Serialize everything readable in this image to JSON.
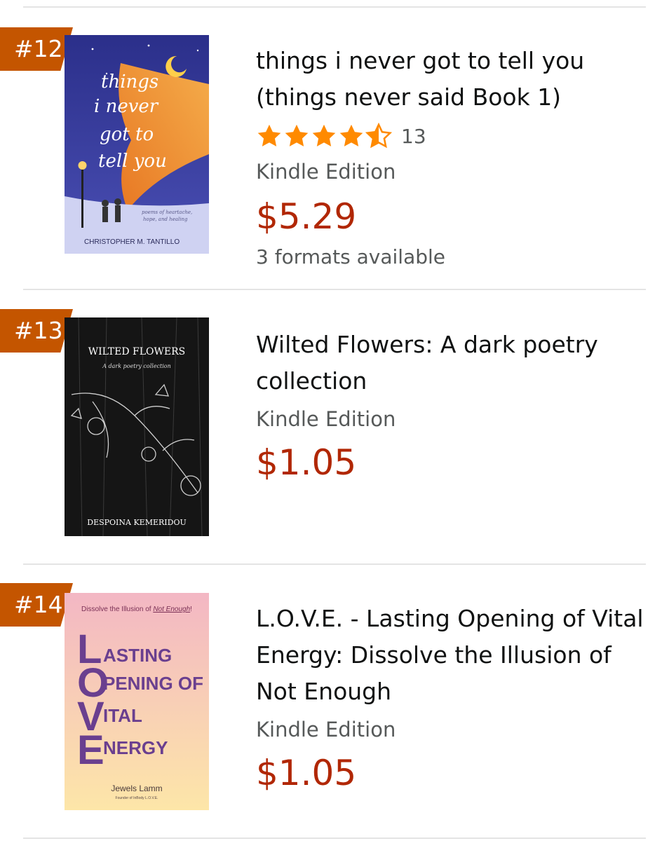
{
  "items": [
    {
      "rank": "#12",
      "title": "things i never got to tell you (things never said Book 1)",
      "rating_value": 4.5,
      "rating_count": "13",
      "format": "Kindle Edition",
      "price": "$5.29",
      "formats_available": "3 formats available",
      "cover": {
        "title_lines": [
          "things",
          "i never",
          "got to",
          "tell you"
        ],
        "subtitle_lines": [
          "poems of heartache,",
          "hope, and healing"
        ],
        "author": "CHRISTOPHER M. TANTILLO",
        "bg": "#3b3f9e",
        "accent": "#f39a2c"
      }
    },
    {
      "rank": "#13",
      "title": "Wilted Flowers: A dark poetry collection",
      "format": "Kindle Edition",
      "price": "$1.05",
      "cover": {
        "title": "WILTED FLOWERS",
        "subtitle": "A dark poetry collection",
        "author": "DESPOINA KEMERIDOU",
        "bg": "#151515"
      }
    },
    {
      "rank": "#14",
      "title": "L.O.V.E. - Lasting Opening of Vital Energy: Dissolve the Illusion of Not Enough",
      "format": "Kindle Edition",
      "price": "$1.05",
      "cover": {
        "tagline_prefix": "Dissolve the Illusion of ",
        "tagline_emph": "Not Enough",
        "tagline_suffix": "!",
        "big_letters": [
          "L",
          "O",
          "V",
          "E"
        ],
        "words": [
          "ASTING",
          "PENING OF",
          "ITAL",
          "NERGY"
        ],
        "author": "Jewels Lamm",
        "author_note": "Founder of InBody L.O.V.E.",
        "bg_top": "#f3b7c4",
        "bg_bottom": "#fde6a8",
        "letter_color": "#6a3f8f"
      }
    }
  ],
  "colors": {
    "badge": "#c45500",
    "price": "#b12704",
    "star": "#ff8a00",
    "divider": "#e4e4e4"
  },
  "icons": [
    "star-full-icon",
    "star-half-icon"
  ]
}
